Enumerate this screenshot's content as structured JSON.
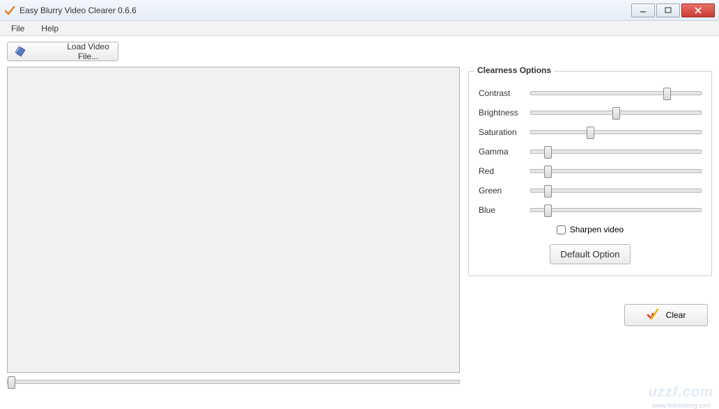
{
  "window": {
    "title": "Easy Blurry Video Clearer 0.6.6"
  },
  "menu": {
    "file": "File",
    "help": "Help"
  },
  "toolbar": {
    "load_label": "Load Video File..."
  },
  "options": {
    "title": "Clearness Options",
    "sliders": [
      {
        "label": "Contrast",
        "value": 80
      },
      {
        "label": "Brightness",
        "value": 50
      },
      {
        "label": "Saturation",
        "value": 35
      },
      {
        "label": "Gamma",
        "value": 10
      },
      {
        "label": "Red",
        "value": 10
      },
      {
        "label": "Green",
        "value": 10
      },
      {
        "label": "Blue",
        "value": 10
      }
    ],
    "sharpen_label": "Sharpen video",
    "sharpen_checked": false,
    "default_label": "Default Option"
  },
  "seek": {
    "value": 0
  },
  "actions": {
    "clear_label": "Clear"
  },
  "watermark": {
    "text": "uzzf.com",
    "sub": "www.feifeixitong.com"
  }
}
